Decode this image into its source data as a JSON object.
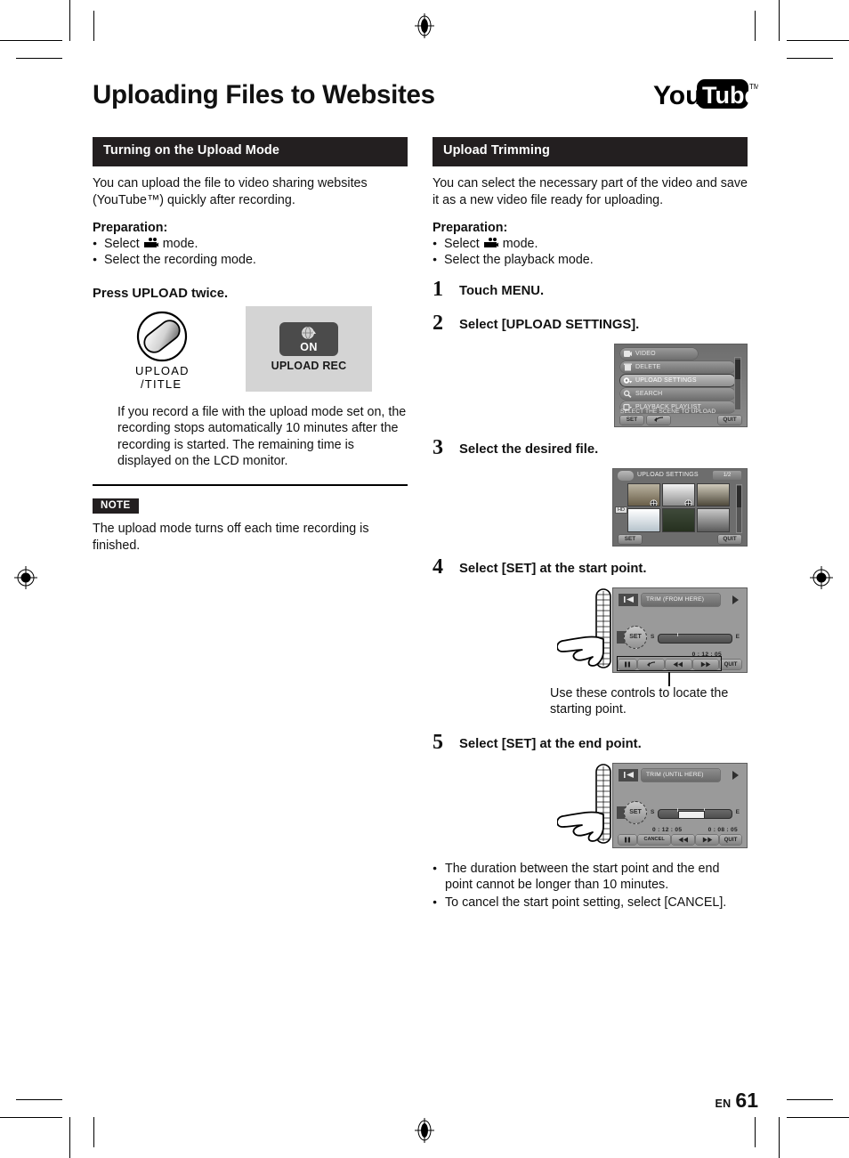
{
  "document": {
    "title": "Uploading Files to Websites",
    "brand_logo": "youtube-logo",
    "folio_prefix": "EN",
    "folio_number": "61"
  },
  "left_column": {
    "section_title": "Turning on the Upload Mode",
    "intro": "You can upload the file to video sharing websites (YouTube™) quickly after recording.",
    "preparation_heading": "Preparation:",
    "preparation_items": [
      {
        "before": "Select",
        "icon": "video-camera-icon",
        "after": "mode."
      },
      {
        "before": "Select the recording mode.",
        "icon": "",
        "after": ""
      }
    ],
    "instruction": "Press UPLOAD twice.",
    "illustration": {
      "button_label_line1": "UPLOAD",
      "button_label_line2": "/TITLE",
      "screen_key_state": "ON",
      "screen_caption": "UPLOAD REC"
    },
    "body_after_illustration": "If you record a file with the upload mode set on, the recording stops automatically 10 minutes after the recording is started. The remaining time is displayed on the LCD monitor.",
    "note_tag": "NOTE",
    "note_text": "The upload mode turns off each time recording is finished."
  },
  "right_column": {
    "section_title": "Upload Trimming",
    "intro": "You can select the necessary part of the video and save it as a new video file ready for uploading.",
    "preparation_heading": "Preparation:",
    "preparation_items": [
      {
        "before": "Select",
        "icon": "video-camera-icon",
        "after": "mode."
      },
      {
        "before": "Select the playback mode.",
        "icon": "",
        "after": ""
      }
    ],
    "steps": [
      {
        "num": "1",
        "text": "Touch MENU."
      },
      {
        "num": "2",
        "text": "Select [UPLOAD SETTINGS]."
      },
      {
        "num": "3",
        "text": "Select the desired file."
      },
      {
        "num": "4",
        "text": "Select [SET] at the start point."
      },
      {
        "num": "5",
        "text": "Select [SET] at the end point."
      }
    ],
    "step4_caption": "Use these controls to locate the starting point.",
    "notes": [
      "The duration between the start point and the end point cannot be longer than 10 minutes.",
      "To cancel the start point setting, select [CANCEL]."
    ]
  },
  "lcd_menu_screen": {
    "items": [
      {
        "label": "VIDEO",
        "icon": "video-icon",
        "selected": false,
        "tab": true
      },
      {
        "label": "DELETE",
        "icon": "trash-icon",
        "selected": false
      },
      {
        "label": "UPLOAD SETTINGS",
        "icon": "upload-settings-icon",
        "selected": true
      },
      {
        "label": "SEARCH",
        "icon": "magnifier-icon",
        "selected": false
      },
      {
        "label": "PLAYBACK PLAYLIST",
        "icon": "playlist-icon",
        "selected": false
      }
    ],
    "caption": "SELECT THE SCENE TO UPLOAD",
    "buttons": {
      "set": "SET",
      "back": "back-arrow-icon",
      "quit": "QUIT"
    }
  },
  "lcd_files_screen": {
    "title": "UPLOAD SETTINGS",
    "page_indicator": "1/2",
    "hd_tag": "HD",
    "buttons": {
      "set": "SET",
      "quit": "QUIT"
    }
  },
  "lcd_trim_start_screen": {
    "title": "TRIM (FROM HERE)",
    "set_label": "SET",
    "slider_start": "S",
    "slider_end": "E",
    "time_value": "0 : 12 : 05",
    "controls": [
      "pause-icon",
      "back-arrow-icon",
      "rewind-icon",
      "forward-icon"
    ],
    "quit": "QUIT"
  },
  "lcd_trim_end_screen": {
    "title": "TRIM (UNTIL HERE)",
    "set_label": "SET",
    "slider_start": "S",
    "slider_end": "E",
    "time_left": "0 : 12 : 05",
    "time_right": "0 : 08 : 05",
    "controls": [
      "pause-icon",
      "CANCEL",
      "rewind-icon",
      "forward-icon"
    ],
    "quit": "QUIT"
  }
}
